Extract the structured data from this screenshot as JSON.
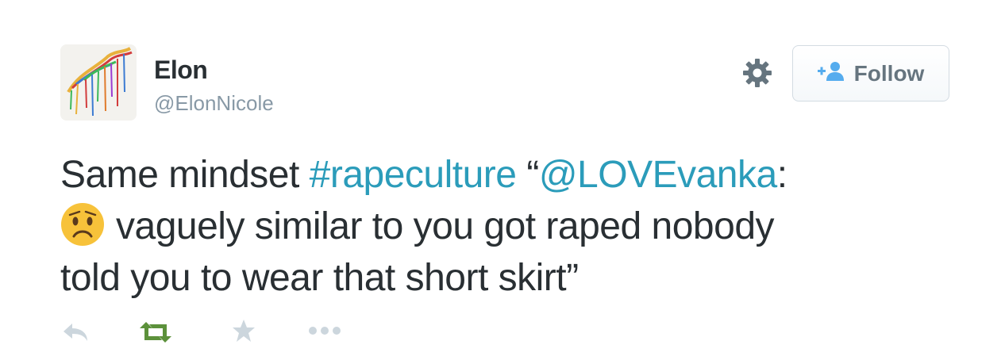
{
  "user": {
    "name": "Elon",
    "handle": "@ElonNicole"
  },
  "header": {
    "follow_label": "Follow",
    "settings_icon": "gear-icon",
    "follow_icon": "add-user-icon"
  },
  "tweet": {
    "line1_a": "Same mindset ",
    "hashtag": "#rapeculture",
    "line1_b": " “",
    "mention": "@LOVEvanka",
    "line1_c": ":",
    "emoji": "worried-face-emoji",
    "line2": "vaguely similar to you got raped nobody",
    "line3": "told you to wear that short skirt”"
  },
  "actions": [
    {
      "name": "reply-icon"
    },
    {
      "name": "retweet-icon"
    },
    {
      "name": "favorite-icon"
    },
    {
      "name": "more-icon"
    }
  ],
  "colors": {
    "link": "#2b9cba",
    "text": "#292f33",
    "muted": "#8899a6",
    "retweet": "#5c913b",
    "follow_icon": "#55acee"
  }
}
